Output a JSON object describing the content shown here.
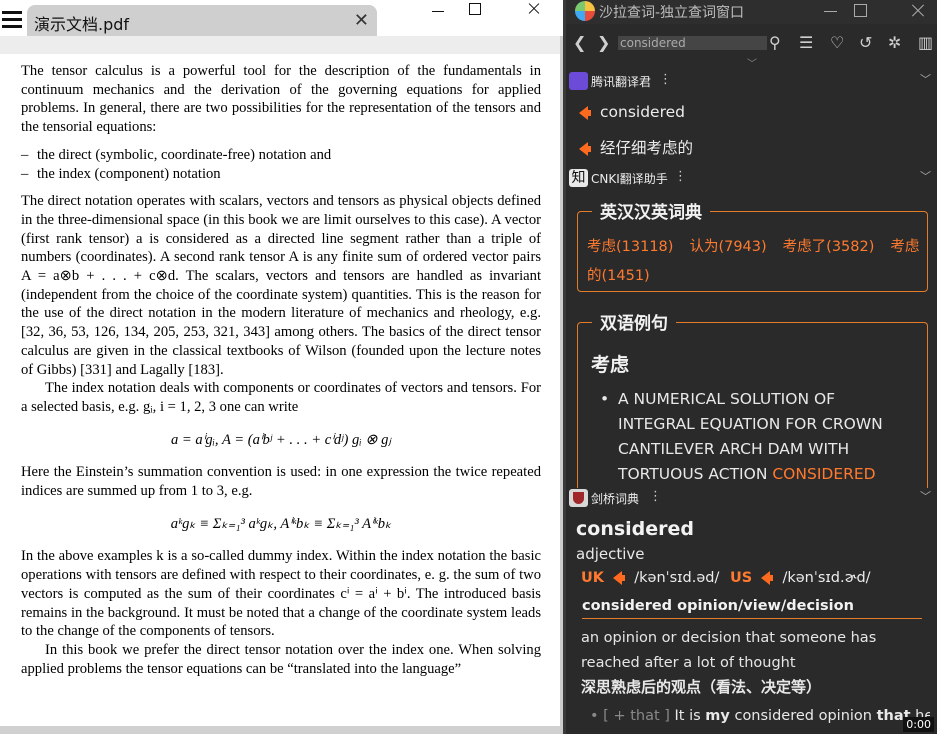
{
  "pdf": {
    "tab_title": "演示文档.pdf",
    "tab_close": "✕",
    "paragraphs": {
      "p1": "The tensor calculus is a powerful tool for the description of the fundamentals in continuum mechanics and the derivation of the governing equations for applied problems. In general, there are two possibilities for the representation of the tensors and the tensorial equations:",
      "li1": "the direct (symbolic, coordinate-free) notation and",
      "li2": "the index (component) notation",
      "p2": "The direct notation operates with scalars, vectors and tensors as physical objects defined in the three-dimensional space (in this book we are limit ourselves to this case). A vector (first rank tensor) a is considered as a directed line segment rather than a triple of numbers (coordinates). A second rank tensor A is any finite sum of ordered vector pairs A = a⊗b + . . . + c⊗d. The scalars, vectors and tensors are handled as invariant (independent from the choice of the coordinate system) quantities. This is the reason for the use of the direct notation in the modern literature of mechanics and rheology, e.g. [32, 36, 53, 126, 134, 205, 253, 321, 343] among others. The basics of the direct tensor calculus are given in the classical textbooks of Wilson (founded upon the lecture notes of Gibbs) [331] and Lagally [183].",
      "p3": "The index notation deals with components or coordinates of vectors and tensors. For a selected basis, e.g. gᵢ, i = 1, 2, 3 one can write",
      "eq1": "a = aⁱgᵢ,    A = (aⁱbʲ + . . . + cⁱdʲ) gᵢ ⊗ gⱼ",
      "p4": "Here the Einstein’s summation convention is used: in one expression the twice repeated indices are summed up from 1 to 3, e.g.",
      "eq2": "aᵏgₖ ≡ Σₖ₌₁³ aᵏgₖ,    Aⁱᵏbₖ ≡ Σₖ₌₁³ Aⁱᵏbₖ",
      "p5": "In the above examples k is a so-called dummy index. Within the index notation the basic operations with tensors are defined with respect to their coordinates, e. g. the sum of two vectors is computed as the sum of their coordinates cⁱ = aⁱ + bⁱ. The introduced basis remains in the background. It must be noted that a change of the coordinate system leads to the change of the components of tensors.",
      "p6": "In this book we prefer the direct tensor notation over the index one. When solving applied problems the tensor equations can be “translated into the language”"
    }
  },
  "dict": {
    "title": "沙拉查词-独立查词窗口",
    "search_value": "considered",
    "tencent": {
      "name": "腾讯翻译君",
      "source": "considered",
      "translation": "经仔细考虑的"
    },
    "cnki": {
      "name": "CNKI翻译助手",
      "section1_title": "英汉汉英词典",
      "keywords": [
        "考虑(13118)",
        "认为(7943)",
        "考虑了(3582)",
        "考虑的(1451)"
      ],
      "section2_title": "双语例句",
      "example_head": "考虑",
      "example_sentence": "A NUMERICAL SOLUTION OF INTEGRAL EQUATION FOR CROWN CANTILEVER ARCH DAM WITH TORTUOUS ACTION ",
      "example_highlight": "CONSIDERED"
    },
    "cambridge": {
      "name": "剑桥词典",
      "headword": "considered",
      "pos": "adjective",
      "uk_label": "UK",
      "uk_ipa": "/kənˈsɪd.əd/",
      "us_label": "US",
      "us_ipa": "/kənˈsɪd.ɚd/",
      "phrase": "considered opinion/view/decision",
      "definition": "an opinion or decision that someone has reached after a lot of thought",
      "definition_cn": "深思熟虑后的观点（看法、决定等）",
      "example_tag": "[ + that ]",
      "example_pre": "It is ",
      "example_bold": "my",
      "example_mid": " considered opinion ",
      "example_bold2": "that",
      "example_post": " he"
    },
    "clock": "0:00"
  },
  "colors": {
    "accent": "#ff7a2f",
    "dict_bg": "#2a2a2a",
    "border": "#e47d2a"
  }
}
